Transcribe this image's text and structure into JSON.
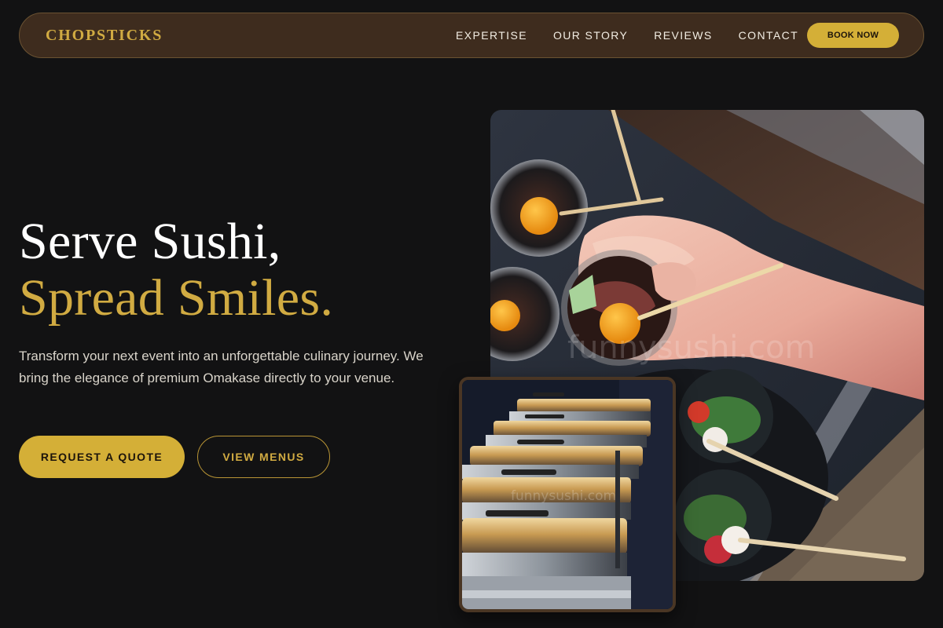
{
  "nav": {
    "brand": "CHOPSTICKS",
    "links": [
      "EXPERTISE",
      "OUR STORY",
      "REVIEWS",
      "CONTACT"
    ],
    "book_label": "BOOK NOW"
  },
  "hero": {
    "title_line1": "Serve Sushi,",
    "title_line2": "Spread Smiles.",
    "description": "Transform your next event into an unforgettable culinary journey. We bring the elegance of premium Omakase directly to your venue.",
    "primary_cta": "REQUEST A QUOTE",
    "secondary_cta": "VIEW MENUS"
  },
  "images": {
    "main_watermark": "funnysushi.com",
    "secondary_watermark": "funnysushi.com"
  },
  "colors": {
    "background": "#121213",
    "nav_background": "#3e2c1e",
    "accent_gold": "#d4af37",
    "text_light": "#ffffff"
  }
}
